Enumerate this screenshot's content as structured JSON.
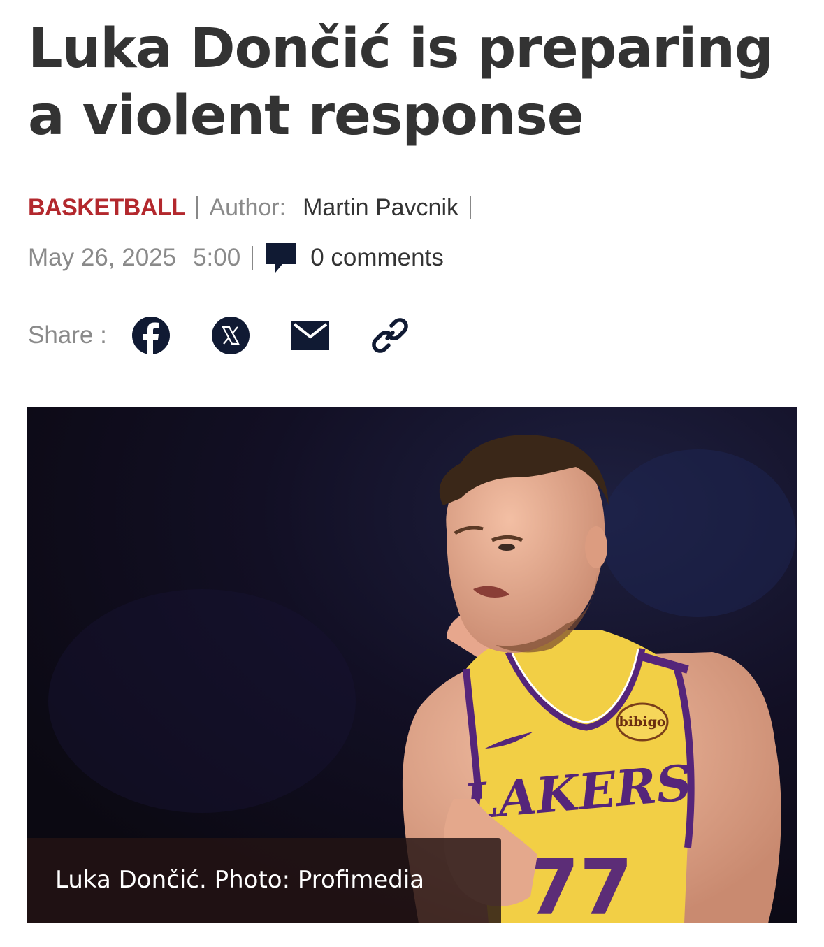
{
  "article": {
    "headline": "Luka Dončić is preparing a violent response",
    "category": "BASKETBALL",
    "author_label": "Author:",
    "author_name": "Martin Pavcnik",
    "date": "May 26, 2025",
    "time": "5:00",
    "comments": "0 comments"
  },
  "share": {
    "label": "Share :",
    "buttons": [
      {
        "icon": "facebook-icon"
      },
      {
        "icon": "x-icon"
      },
      {
        "icon": "email-icon"
      },
      {
        "icon": "link-icon"
      }
    ]
  },
  "photo": {
    "caption": "Luka Dončić. Photo: Profimedia",
    "jersey_text": "LAKERS",
    "sponsor_text": "bibigo"
  },
  "colors": {
    "headline": "#333333",
    "category": "#b3282d",
    "muted": "#8a8a8a",
    "icon": "#101a33",
    "jersey_gold": "#f2cf45",
    "jersey_purple": "#55257a"
  }
}
